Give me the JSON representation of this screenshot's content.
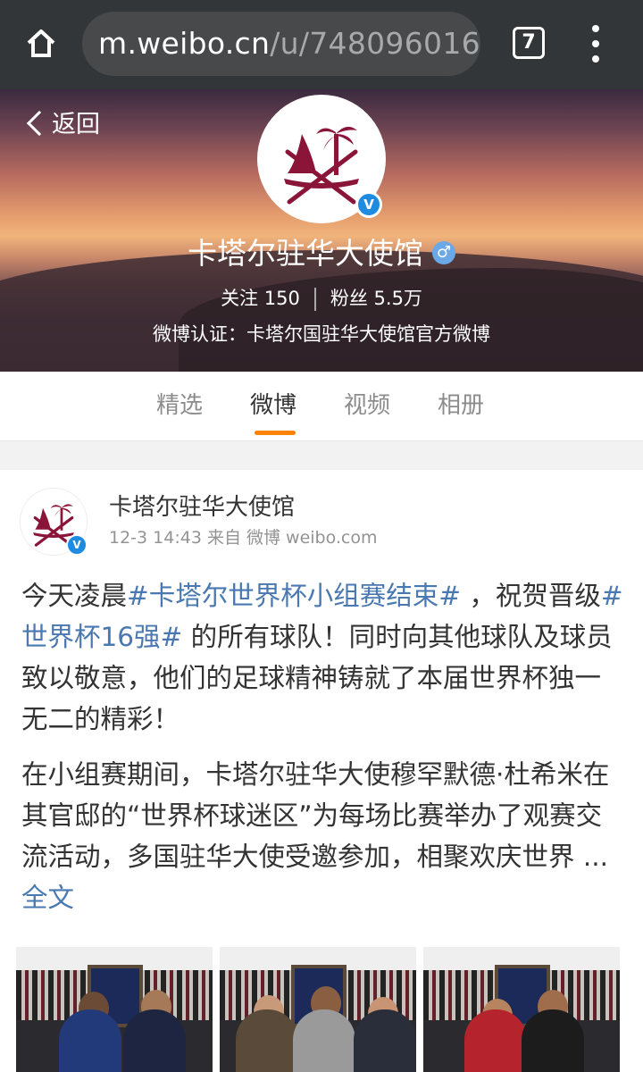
{
  "browser": {
    "url_host": "m.weibo.cn",
    "url_path": "/u/748096016",
    "tab_count": "7",
    "icons": {
      "home": "home-icon",
      "menu": "more-vertical-icon"
    }
  },
  "profile": {
    "back_label": "返回",
    "name": "卡塔尔驻华大使馆",
    "gender_symbol": "♂",
    "following_label": "关注",
    "following_count": "150",
    "followers_label": "粉丝",
    "followers_count": "5.5万",
    "certification": "微博认证：卡塔尔国驻华大使馆官方微博",
    "verified_mark": "V"
  },
  "tabs": [
    {
      "label": "精选",
      "active": false
    },
    {
      "label": "微博",
      "active": true
    },
    {
      "label": "视频",
      "active": false
    },
    {
      "label": "相册",
      "active": false
    }
  ],
  "post": {
    "author": "卡塔尔驻华大使馆",
    "meta": "12-3 14:43 来自 微博 weibo.com",
    "p1_a": "今天凌晨",
    "p1_tag1": "#卡塔尔世界杯小组赛结束#",
    "p1_b": " ，祝贺晋级",
    "p1_tag2": "#世界杯16强#",
    "p1_c": " 的所有球队！同时向其他球队及球员致以敬意，他们的足球精神铸就了本届世界杯独一无二的精彩！",
    "p2": "在小组赛期间，卡塔尔驻华大使穆罕默德·杜希米在其官邸的“世界杯球迷区”为每场比赛举办了观赛交流活动，多国驻华大使受邀参加，相聚欢庆世界 ...",
    "more_label": "全文"
  },
  "colors": {
    "accent_orange": "#ff8200",
    "link_blue": "#4a78b0",
    "verified_blue": "#1e8be0",
    "qatar_maroon": "#8a1538"
  }
}
